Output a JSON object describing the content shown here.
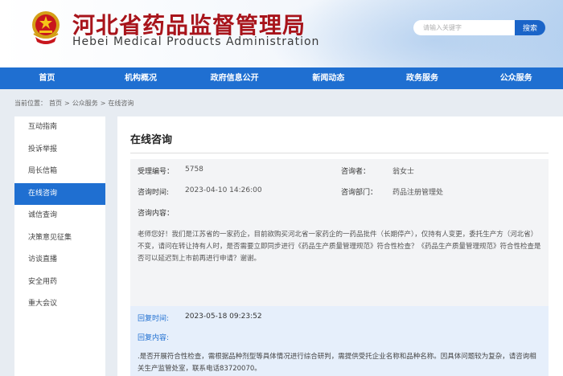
{
  "header": {
    "title_cn": "河北省药品监督管理局",
    "title_en": "Hebei Medical Products Administration",
    "emblem_icon": "national-emblem-icon",
    "search_placeholder": "请输入关键字",
    "search_button": "搜索"
  },
  "nav": [
    "首页",
    "机构概况",
    "政府信息公开",
    "新闻动态",
    "政务服务",
    "公众服务"
  ],
  "breadcrumb": {
    "prefix": "当前位置：",
    "items": [
      "首页",
      "公众服务",
      "在线咨询"
    ],
    "separator": ">"
  },
  "sidebar": {
    "items": [
      "互动指南",
      "投诉举报",
      "局长信箱",
      "在线咨询",
      "诚信查询",
      "决策意见征集",
      "访谈直播",
      "安全用药",
      "重大会议"
    ],
    "active_index": 3
  },
  "page_title": "在线咨询",
  "consult": {
    "id_label": "受理编号：",
    "id_value": "5758",
    "person_label": "咨询者：",
    "person_value": "翁女士",
    "time_label": "咨询时间:",
    "time_value": "2023-04-10 14:26:00",
    "dept_label": "咨询部门：",
    "dept_value": "药品注册管理处",
    "content_label": "咨询内容：",
    "content": "老师您好！我们是江苏省的一家药企，目前欲购买河北省一家药企的一药品批件（长期停产），仅持有人变更，委托生产方（河北省）不变，请问在转让持有人时，是否需要立即同步进行《药品生产质量管理规范》符合性检查？《药品生产质量管理规范》符合性检查是否可以延迟到上市前再进行申请？谢谢。"
  },
  "reply": {
    "time_label": "回复时间:",
    "time_value": "2023-05-18 09:23:52",
    "content_label": "回复内容:",
    "content": ".是否开展符合性检查，需根据品种剂型等具体情况进行综合研判，需提供受托企业名称和品种名称。因具体问题较为复杂，请咨询相关生产监管处室，联系电话83720070。"
  },
  "colors": {
    "brand_blue": "#1f6fd1",
    "title_red": "#a8141b",
    "page_bg": "#e7ecf2"
  }
}
